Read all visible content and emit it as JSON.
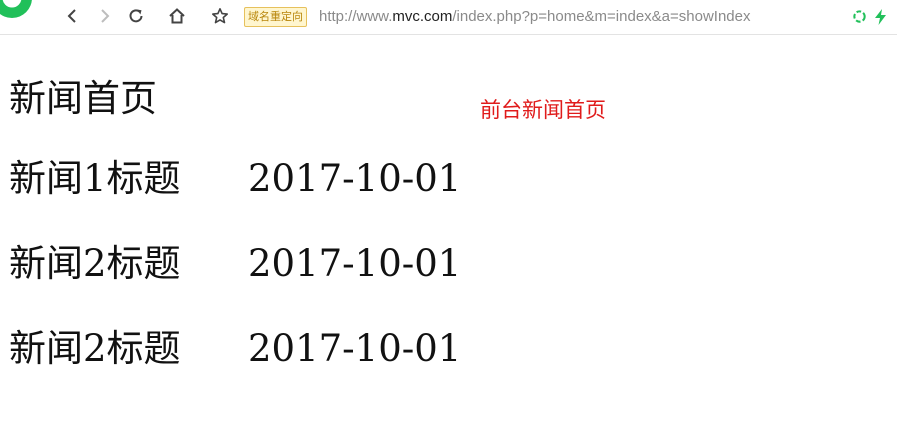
{
  "toolbar": {
    "redirect_badge": "域名重定向",
    "url_prefix": "http://www.",
    "url_host": "mvc.com",
    "url_path": "/index.php?p=home&m=index&a=showIndex",
    "icons": [
      "back-icon",
      "forward-icon",
      "reload-icon",
      "home-icon",
      "star-icon",
      "recycle-icon",
      "lightning-icon"
    ]
  },
  "page": {
    "heading": "新闻首页",
    "front_label": "前台新闻首页",
    "news": [
      {
        "title": "新闻1标题",
        "date": "2017-10-01"
      },
      {
        "title": "新闻2标题",
        "date": "2017-10-01"
      },
      {
        "title": "新闻2标题",
        "date": "2017-10-01"
      }
    ]
  },
  "colors": {
    "front_label": "#e01b1b",
    "brand_green": "#21c05a",
    "badge_bg": "#fff6cf"
  }
}
